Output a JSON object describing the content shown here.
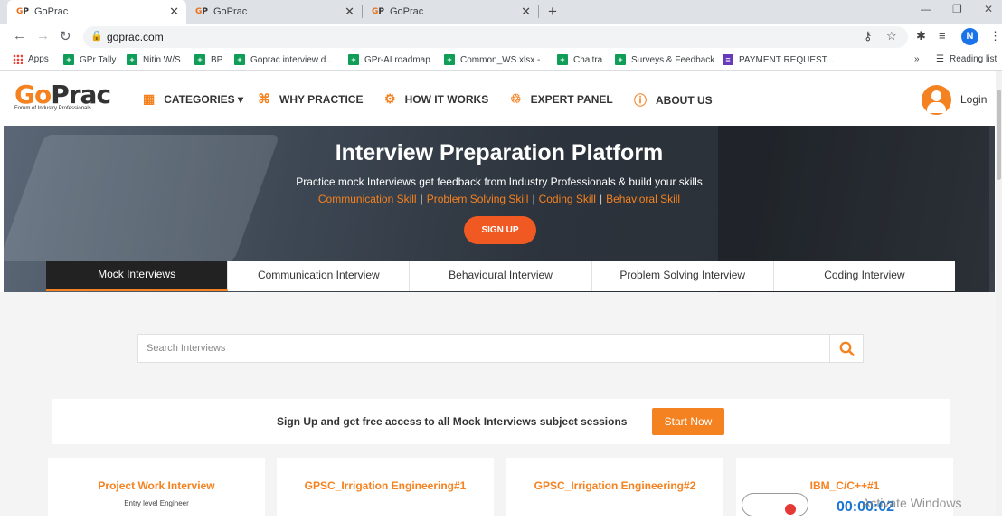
{
  "browser": {
    "tabs": [
      {
        "favicon": "GP",
        "title": "GoPrac",
        "active": true
      },
      {
        "favicon": "GP",
        "title": "GoPrac",
        "active": false
      },
      {
        "favicon": "GP",
        "title": "GoPrac",
        "active": false
      }
    ],
    "url": "goprac.com",
    "profile_initial": "N",
    "bookmarks": [
      {
        "label": "Apps",
        "icon": "apps-icon"
      },
      {
        "label": "GPr Tally",
        "icon": "sheets-icon"
      },
      {
        "label": "Nitin W/S",
        "icon": "sheets-icon"
      },
      {
        "label": "BP",
        "icon": "sheets-icon"
      },
      {
        "label": "Goprac interview d...",
        "icon": "sheets-icon"
      },
      {
        "label": "GPr-AI roadmap",
        "icon": "sheets-icon"
      },
      {
        "label": "Common_WS.xlsx -...",
        "icon": "sheets-icon"
      },
      {
        "label": "Chaitra",
        "icon": "sheets-icon"
      },
      {
        "label": "Surveys & Feedback",
        "icon": "sheets-icon"
      },
      {
        "label": "PAYMENT REQUEST...",
        "icon": "forms-icon"
      }
    ],
    "more_bookmarks": "»",
    "reading_list": "Reading list"
  },
  "site": {
    "logo_go": "Go",
    "logo_prac": "Prac",
    "logo_tagline": "Forum of Industry Professionals",
    "nav": [
      {
        "label": "CATEGORIES ▾",
        "icon": "grid-icon"
      },
      {
        "label": "WHY PRACTICE",
        "icon": "gift-icon"
      },
      {
        "label": "HOW IT WORKS",
        "icon": "gears-icon"
      },
      {
        "label": "EXPERT PANEL",
        "icon": "handshake-icon"
      },
      {
        "label": "ABOUT US",
        "icon": "info-icon"
      }
    ],
    "login": "Login"
  },
  "hero": {
    "title": "Interview Preparation Platform",
    "subtitle": "Practice mock Interviews get feedback from Industry Professionals & build your skills",
    "skills": [
      "Communication Skill",
      "Problem Solving Skill",
      "Coding Skill",
      "Behavioral Skill"
    ],
    "signup": "SIGN UP"
  },
  "interview_tabs": [
    "Mock Interviews",
    "Communication Interview",
    "Behavioural Interview",
    "Problem Solving Interview",
    "Coding Interview"
  ],
  "search": {
    "placeholder": "Search Interviews"
  },
  "promo": {
    "text": "Sign Up and get free access to all Mock Interviews subject sessions",
    "button": "Start Now"
  },
  "cards": [
    {
      "title": "Project Work Interview",
      "subtitle": "Entry level Engineer"
    },
    {
      "title": "GPSC_Irrigation Engineering#1",
      "subtitle": ""
    },
    {
      "title": "GPSC_Irrigation Engineering#2",
      "subtitle": ""
    },
    {
      "title": "IBM_C/C++#1",
      "subtitle": ""
    }
  ],
  "overlay": {
    "timer": "00:00:02",
    "watermark": "Activate Windows"
  },
  "colors": {
    "accent": "#f58220",
    "signup": "#f05a22",
    "hero_bg": "#2c333c"
  }
}
